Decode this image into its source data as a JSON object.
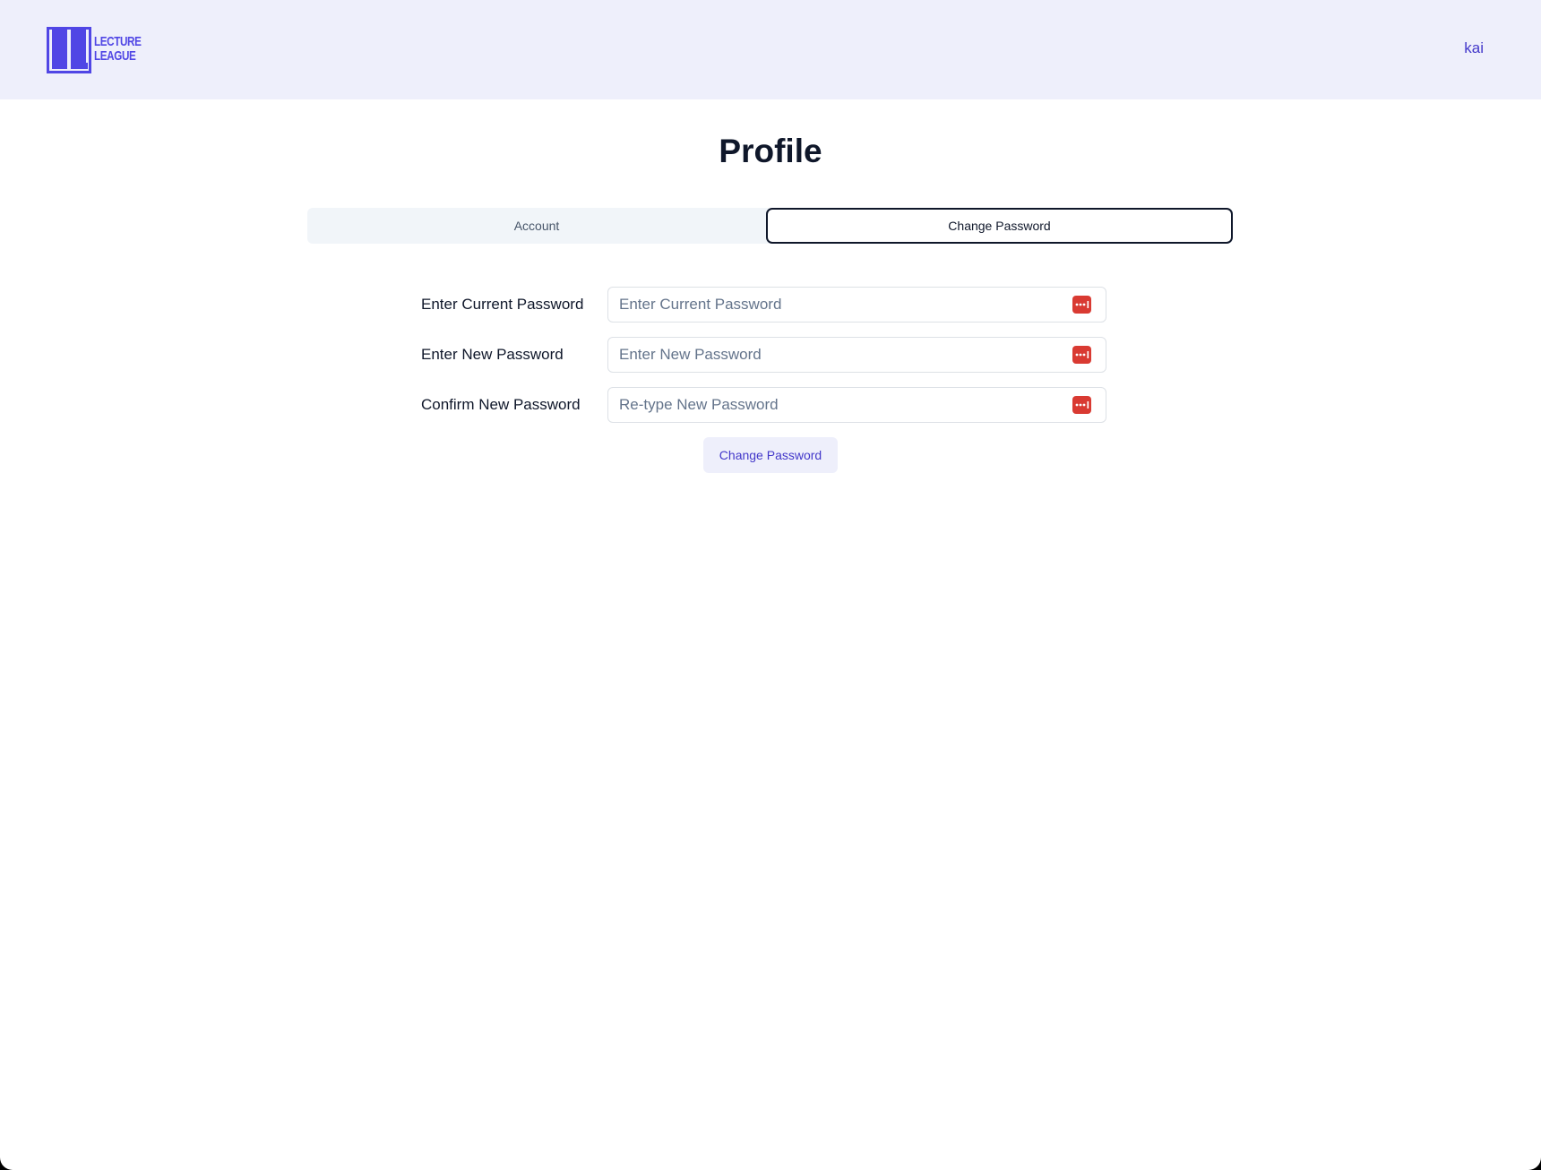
{
  "header": {
    "logo_line1": "LECTURE",
    "logo_line2": "LEAGUE",
    "user_name": "kai"
  },
  "page": {
    "title": "Profile"
  },
  "tabs": [
    {
      "label": "Account",
      "active": false
    },
    {
      "label": "Change Password",
      "active": true
    }
  ],
  "form": {
    "fields": [
      {
        "label": "Enter Current Password",
        "placeholder": "Enter Current Password",
        "value": ""
      },
      {
        "label": "Enter New Password",
        "placeholder": "Enter New Password",
        "value": ""
      },
      {
        "label": "Confirm New Password",
        "placeholder": "Re-type New Password",
        "value": ""
      }
    ],
    "submit_label": "Change Password"
  },
  "icons": {
    "logo": "lecture-league-logo",
    "password_manager": "password-key-icon"
  },
  "colors": {
    "brand": "#5046e5",
    "header_bg": "#eeeffb",
    "link": "#4338ca",
    "key_icon": "#d93a32"
  }
}
